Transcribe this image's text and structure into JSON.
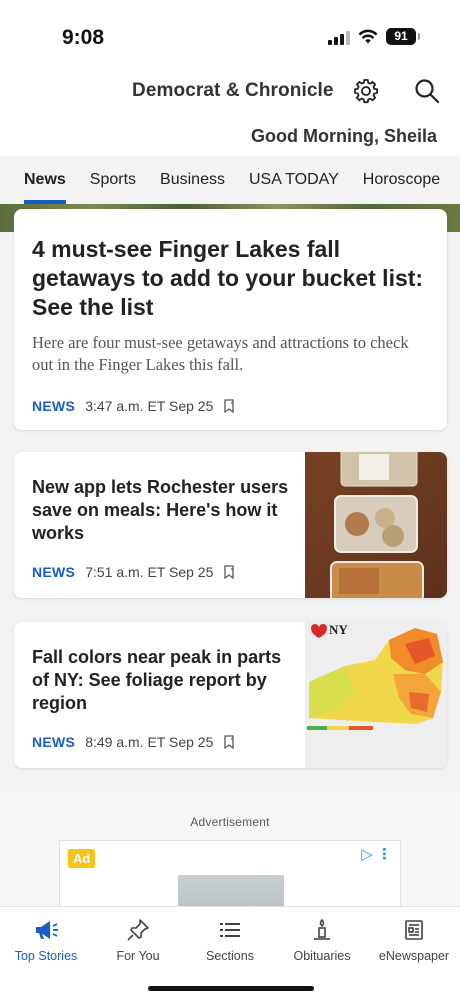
{
  "status_bar": {
    "time": "9:08",
    "battery": "91"
  },
  "header": {
    "brand": "Democrat & Chronicle",
    "settings_icon": "gear-icon",
    "search_icon": "search-icon",
    "greeting": "Good Morning, Sheila"
  },
  "tabs": [
    {
      "label": "News",
      "active": true
    },
    {
      "label": "Sports"
    },
    {
      "label": "Business"
    },
    {
      "label": "USA TODAY"
    },
    {
      "label": "Horoscope"
    }
  ],
  "articles": [
    {
      "title": "4 must-see Finger Lakes fall getaways to add to your bucket list: See the list",
      "summary": "Here are four must-see getaways and attractions to check out in the Finger Lakes this fall.",
      "tag": "NEWS",
      "time": "3:47 a.m. ET Sep 25"
    },
    {
      "title": "New app lets Rochester users save on meals: Here's how it works",
      "tag": "NEWS",
      "time": "7:51 a.m. ET Sep 25"
    },
    {
      "title": "Fall colors near peak in parts of NY: See foliage report by region",
      "tag": "NEWS",
      "time": "8:49 a.m. ET Sep 25"
    }
  ],
  "ad": {
    "label": "Advertisement",
    "badge": "Ad"
  },
  "bottom_nav": [
    {
      "label": "Top Stories",
      "icon": "megaphone-icon",
      "active": true
    },
    {
      "label": "For You",
      "icon": "pin-icon"
    },
    {
      "label": "Sections",
      "icon": "list-icon"
    },
    {
      "label": "Obituaries",
      "icon": "candle-icon"
    },
    {
      "label": "eNewspaper",
      "icon": "newspaper-icon"
    }
  ],
  "colors": {
    "accent": "#1a5dc0",
    "tab_bar_bg": "#f3f3f3"
  }
}
